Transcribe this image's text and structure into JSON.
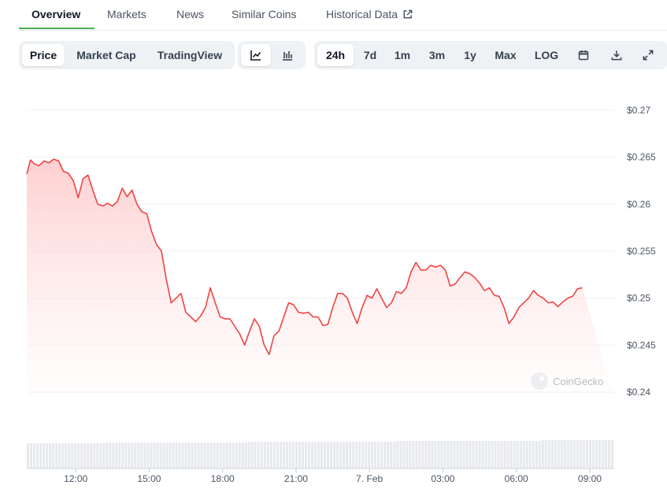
{
  "tabs": [
    {
      "label": "Overview",
      "active": true
    },
    {
      "label": "Markets",
      "active": false
    },
    {
      "label": "News",
      "active": false
    },
    {
      "label": "Similar Coins",
      "active": false
    },
    {
      "label": "Historical Data",
      "active": false
    }
  ],
  "chart_type_buttons": [
    {
      "label": "Price",
      "active": true
    },
    {
      "label": "Market Cap",
      "active": false
    },
    {
      "label": "TradingView",
      "active": false
    }
  ],
  "view_icons": [
    {
      "icon": "line-chart-icon",
      "active": true
    },
    {
      "icon": "candlestick-chart-icon",
      "active": false
    }
  ],
  "range_buttons": [
    {
      "label": "24h",
      "active": true
    },
    {
      "label": "7d",
      "active": false
    },
    {
      "label": "1m",
      "active": false
    },
    {
      "label": "3m",
      "active": false
    },
    {
      "label": "1y",
      "active": false
    },
    {
      "label": "Max",
      "active": false
    },
    {
      "label": "LOG",
      "active": false
    }
  ],
  "tool_icons": [
    "calendar-icon",
    "download-icon",
    "fullscreen-icon"
  ],
  "watermark": "CoinGecko",
  "colors": {
    "accent": "#4caf50",
    "line": "#ef4444",
    "fill_top": "#fecaca",
    "text_muted": "#4b5563",
    "grid": "#eef0f3"
  },
  "chart_data": {
    "type": "area",
    "y_ticks": [
      "$0.27",
      "$0.265",
      "$0.26",
      "$0.255",
      "$0.25",
      "$0.245",
      "$0.24"
    ],
    "x_ticks": [
      "12:00",
      "15:00",
      "18:00",
      "21:00",
      "7. Feb",
      "03:00",
      "06:00",
      "09:00"
    ],
    "ylim": [
      0.24,
      0.27
    ],
    "grid": true,
    "x_hours": [
      0,
      0.15,
      0.3,
      0.5,
      0.7,
      0.9,
      1.1,
      1.3,
      1.5,
      1.7,
      1.9,
      2.1,
      2.3,
      2.5,
      2.7,
      2.9,
      3.1,
      3.3,
      3.5,
      3.7,
      3.9,
      4.1,
      4.3,
      4.5,
      4.7,
      4.9,
      5.1,
      5.3,
      5.5,
      5.7,
      5.9,
      6.1,
      6.3,
      6.5,
      6.7,
      6.9,
      7.1,
      7.3,
      7.5,
      7.7,
      7.9,
      8.1,
      8.3,
      8.5,
      8.7,
      8.9,
      9.1,
      9.3,
      9.5,
      9.7,
      9.9,
      10.1,
      10.3,
      10.5,
      10.7,
      10.9,
      11.1,
      11.3,
      11.5,
      11.7,
      11.9,
      12.1,
      12.3,
      12.5,
      12.7,
      12.9,
      13.1,
      13.3,
      13.5,
      13.7,
      13.9,
      14.1,
      14.3,
      14.5,
      14.7,
      14.9,
      15.1,
      15.3,
      15.5,
      15.7,
      15.9,
      16.1,
      16.3,
      16.5,
      16.7,
      16.9,
      17.1,
      17.3,
      17.5,
      17.7,
      17.9,
      18.1,
      18.3,
      18.5,
      18.7,
      18.9,
      19.1,
      19.3,
      19.5,
      19.7,
      19.9,
      20.1,
      20.3,
      20.5,
      20.7,
      20.9,
      21.1,
      21.3,
      21.5,
      21.7,
      21.9,
      22.1,
      22.3,
      22.5,
      22.7,
      22.9,
      23.1,
      23.3,
      23.5,
      23.7,
      23.9,
      24.0
    ],
    "prices": [
      0.2632,
      0.2647,
      0.2643,
      0.2641,
      0.2646,
      0.2644,
      0.2648,
      0.2646,
      0.2635,
      0.2633,
      0.2625,
      0.2607,
      0.2627,
      0.2631,
      0.2615,
      0.26,
      0.2598,
      0.2601,
      0.2598,
      0.2603,
      0.2617,
      0.2608,
      0.2615,
      0.26,
      0.2592,
      0.259,
      0.2571,
      0.2557,
      0.255,
      0.252,
      0.2495,
      0.25,
      0.2505,
      0.2485,
      0.248,
      0.2475,
      0.2481,
      0.249,
      0.2511,
      0.2495,
      0.248,
      0.2478,
      0.2478,
      0.247,
      0.2462,
      0.245,
      0.2465,
      0.2478,
      0.247,
      0.245,
      0.244,
      0.246,
      0.2465,
      0.248,
      0.2495,
      0.2493,
      0.2485,
      0.2484,
      0.2485,
      0.248,
      0.248,
      0.2471,
      0.2472,
      0.249,
      0.2505,
      0.2505,
      0.25,
      0.2485,
      0.2473,
      0.249,
      0.2503,
      0.25,
      0.251,
      0.25,
      0.249,
      0.2495,
      0.2507,
      0.2505,
      0.2511,
      0.2528,
      0.2538,
      0.253,
      0.253,
      0.2535,
      0.2533,
      0.2535,
      0.253,
      0.2513,
      0.2515,
      0.2522,
      0.2528,
      0.2526,
      0.2522,
      0.2516,
      0.2508,
      0.2511,
      0.2503,
      0.2502,
      0.249,
      0.2473,
      0.248,
      0.249,
      0.2495,
      0.25,
      0.2508,
      0.2503,
      0.25,
      0.2495,
      0.2496,
      0.2491,
      0.2496,
      0.25,
      0.2502,
      0.251,
      0.2511
    ],
    "volume_note": "volume bars shown below price area"
  }
}
